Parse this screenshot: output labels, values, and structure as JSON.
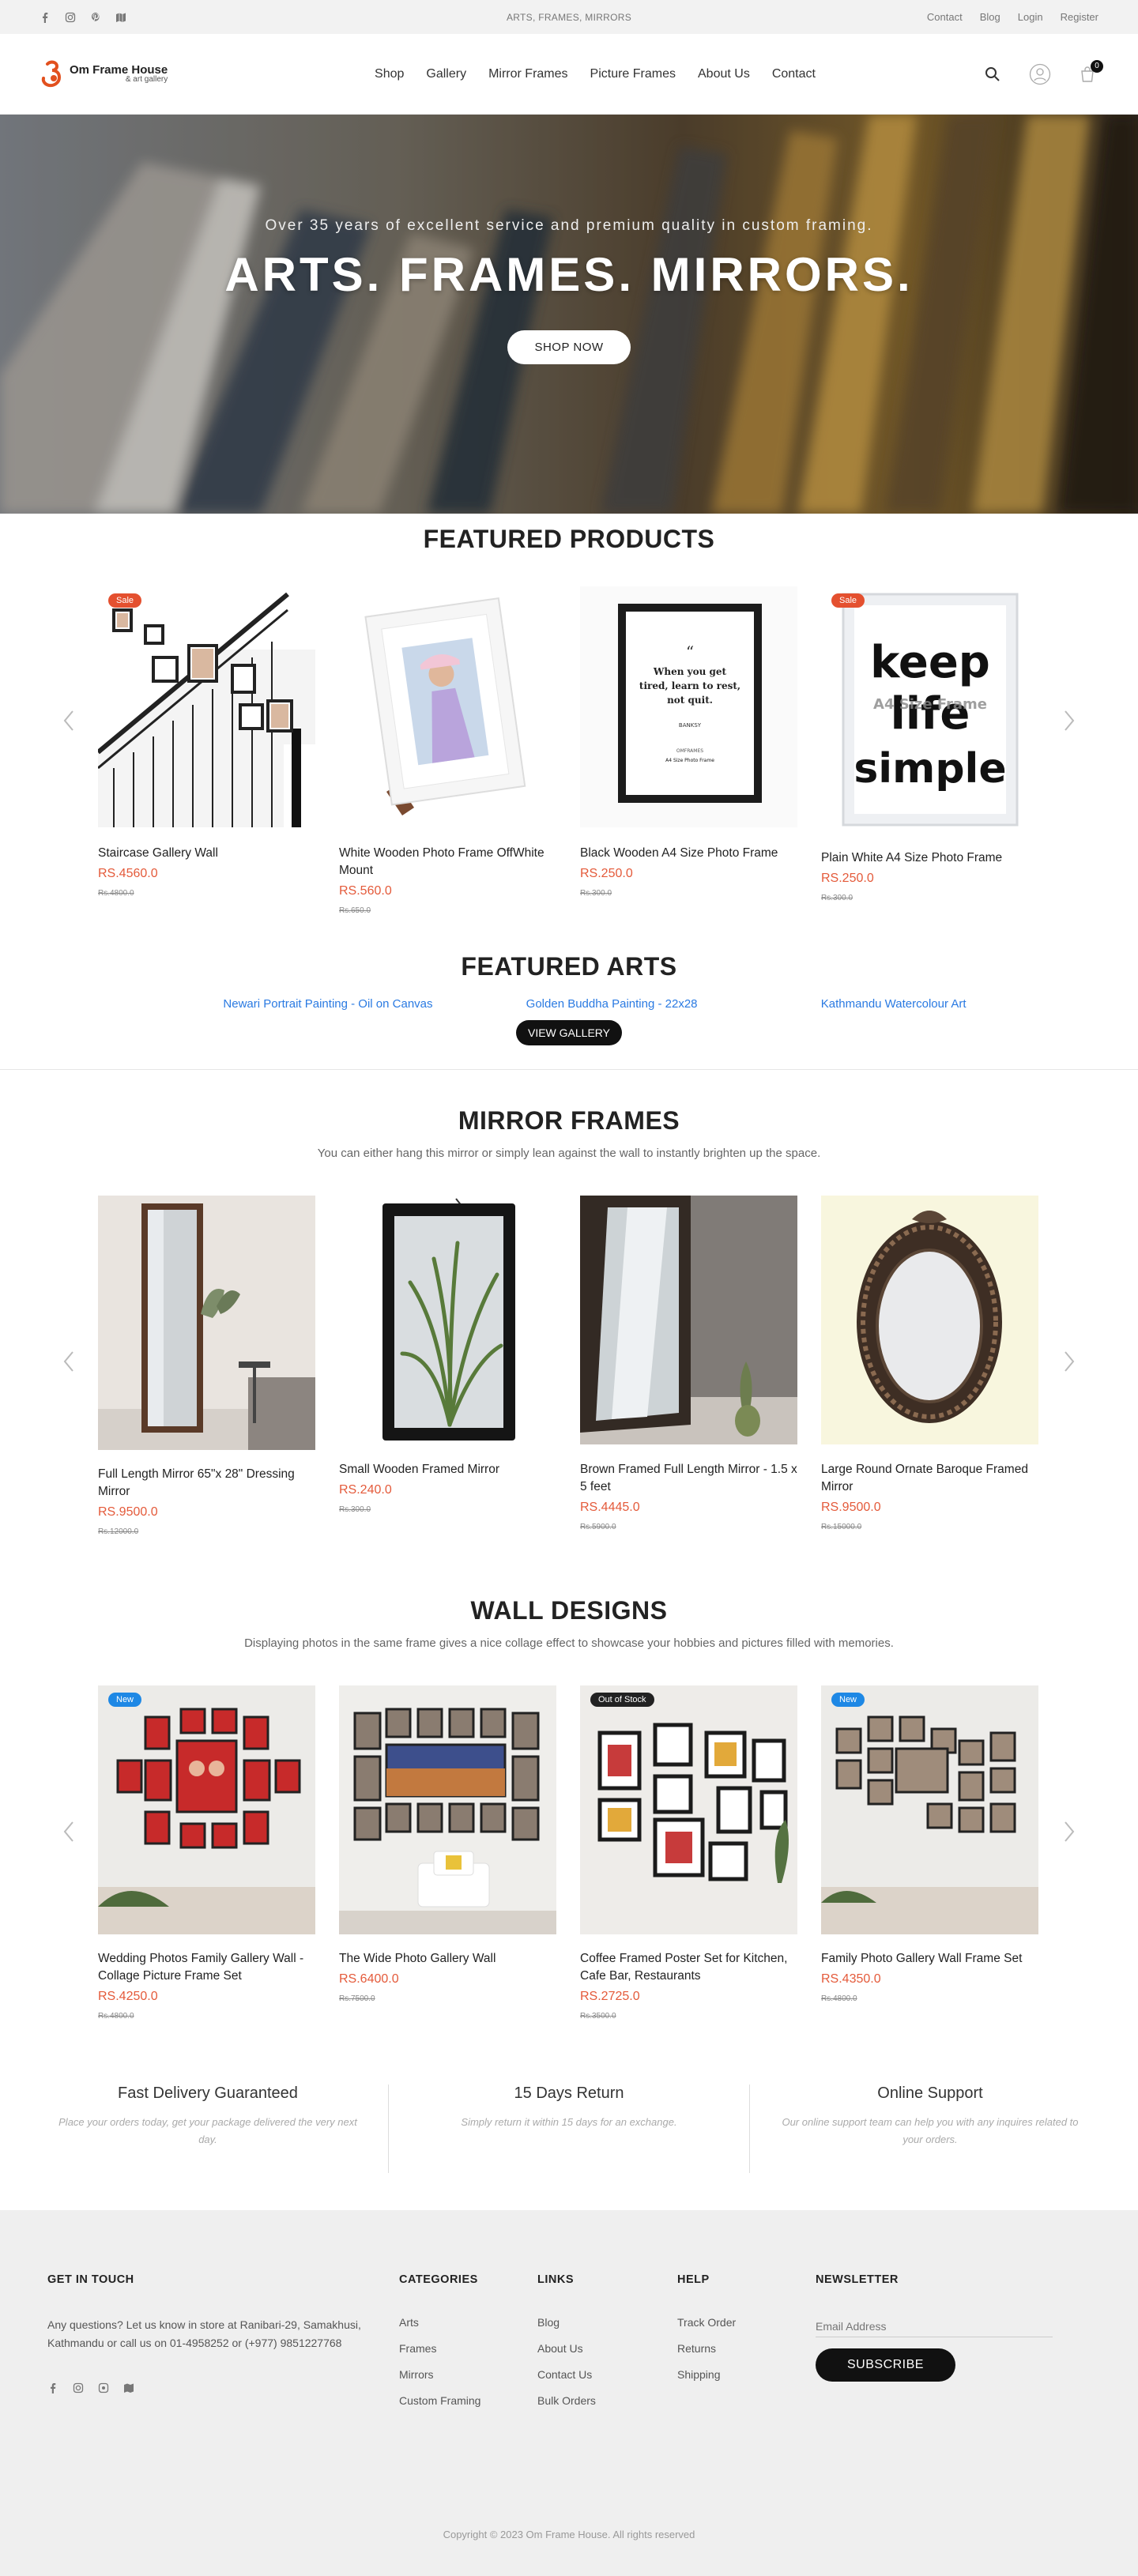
{
  "topbar": {
    "center": "ARTS, FRAMES, MIRRORS",
    "links": [
      "Contact",
      "Blog",
      "Login",
      "Register"
    ],
    "social_icons": [
      "facebook-icon",
      "instagram-icon",
      "pinterest-icon",
      "map-icon"
    ]
  },
  "header": {
    "logo_name": "Om Frame House",
    "logo_tagline": "& art gallery",
    "nav": [
      "Shop",
      "Gallery",
      "Mirror Frames",
      "Picture Frames",
      "About Us",
      "Contact"
    ],
    "cart_count": "0"
  },
  "hero": {
    "subtitle": "Over 35 years of excellent service and premium quality in custom framing.",
    "title": "ARTS. FRAMES. MIRRORS.",
    "button": "SHOP NOW"
  },
  "featured_products": {
    "title": "FEATURED PRODUCTS",
    "items": [
      {
        "name": "Staircase Gallery Wall",
        "price": "RS.4560.0",
        "old": "Rs.4800.0",
        "badge": "Sale"
      },
      {
        "name": "White Wooden Photo Frame OffWhite Mount",
        "price": "RS.560.0",
        "old": "Rs.650.0",
        "badge": ""
      },
      {
        "name": "Black Wooden A4 Size Photo Frame",
        "price": "RS.250.0",
        "old": "Rs.300.0",
        "badge": ""
      },
      {
        "name": "Plain White A4 Size Photo Frame",
        "price": "RS.250.0",
        "old": "Rs.300.0",
        "badge": "Sale"
      }
    ]
  },
  "featured_arts": {
    "title": "FEATURED ARTS",
    "items": [
      "Newari Portrait Painting - Oil on Canvas",
      "Golden Buddha Painting - 22x28",
      "Kathmandu Watercolour Art"
    ],
    "button": "VIEW GALLERY"
  },
  "mirror_frames": {
    "title": "MIRROR FRAMES",
    "subtitle": "You can either hang this mirror or simply lean against the wall to instantly brighten up the space.",
    "items": [
      {
        "name": "Full Length Mirror 65\"x 28\" Dressing Mirror",
        "price": "RS.9500.0",
        "old": "Rs.12000.0"
      },
      {
        "name": "Small Wooden Framed Mirror",
        "price": "RS.240.0",
        "old": "Rs.300.0"
      },
      {
        "name": "Brown Framed Full Length Mirror - 1.5 x 5 feet",
        "price": "RS.4445.0",
        "old": "Rs.5900.0"
      },
      {
        "name": "Large Round Ornate Baroque Framed Mirror",
        "price": "RS.9500.0",
        "old": "Rs.15000.0"
      }
    ]
  },
  "wall_designs": {
    "title": "WALL DESIGNS",
    "subtitle": "Displaying photos in the same frame gives a nice collage effect to showcase your hobbies and pictures filled with memories.",
    "items": [
      {
        "name": "Wedding Photos Family Gallery Wall - Collage Picture Frame Set",
        "price": "RS.4250.0",
        "old": "Rs.4800.0",
        "badge": "New"
      },
      {
        "name": "The Wide Photo Gallery Wall",
        "price": "RS.6400.0",
        "old": "Rs.7500.0",
        "badge": ""
      },
      {
        "name": "Coffee Framed Poster Set for Kitchen, Cafe Bar, Restaurants",
        "price": "RS.2725.0",
        "old": "Rs.3500.0",
        "badge": "Out of Stock"
      },
      {
        "name": "Family Photo Gallery Wall Frame Set",
        "price": "RS.4350.0",
        "old": "Rs.4800.0",
        "badge": "New"
      }
    ]
  },
  "features": [
    {
      "title": "Fast Delivery Guaranteed",
      "text": "Place your orders today, get your package delivered the very next day."
    },
    {
      "title": "15 Days Return",
      "text": "Simply return it within 15 days for an exchange."
    },
    {
      "title": "Online Support",
      "text": "Our online support team can help you with any inquires related to your orders."
    }
  ],
  "footer": {
    "contact_title": "GET IN TOUCH",
    "contact_text": "Any questions? Let us know in store at Ranibari-29, Samakhusi, Kathmandu or call us on 01-4958252 or (+977) 9851227768",
    "categories_title": "CATEGORIES",
    "categories": [
      "Arts",
      "Frames",
      "Mirrors",
      "Custom Framing"
    ],
    "links_title": "LINKS",
    "links": [
      "Blog",
      "About Us",
      "Contact Us",
      "Bulk Orders"
    ],
    "help_title": "HELP",
    "help": [
      "Track Order",
      "Returns",
      "Shipping"
    ],
    "newsletter_title": "NEWSLETTER",
    "email_placeholder": "Email Address",
    "subscribe": "SUBSCRIBE",
    "copyright": "Copyright © 2023 Om Frame House. All rights reserved"
  },
  "colors": {
    "accent": "#e45a3a",
    "badge_sale": "#e4502f",
    "badge_new": "#1e88e5",
    "dark": "#111111"
  }
}
